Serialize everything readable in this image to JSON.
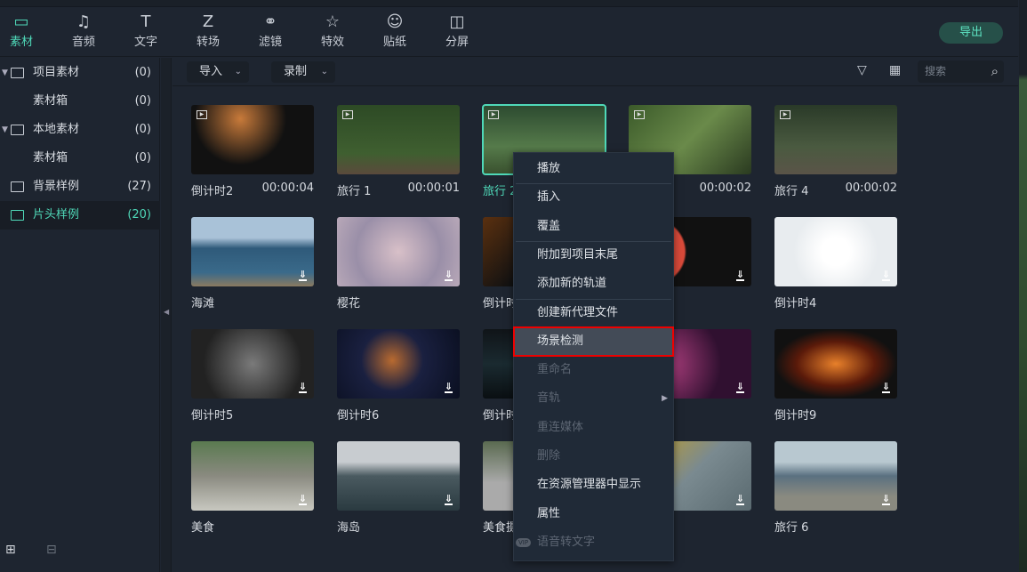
{
  "tabs": [
    {
      "label": "素材",
      "icon": "media-icon",
      "glyph": "▭"
    },
    {
      "label": "音频",
      "icon": "music-icon",
      "glyph": "♫"
    },
    {
      "label": "文字",
      "icon": "text-icon",
      "glyph": "T"
    },
    {
      "label": "转场",
      "icon": "transition-icon",
      "glyph": "Z"
    },
    {
      "label": "滤镜",
      "icon": "filter-icon",
      "glyph": "⚭"
    },
    {
      "label": "特效",
      "icon": "effects-icon",
      "glyph": "☆"
    },
    {
      "label": "贴纸",
      "icon": "sticker-icon",
      "glyph": "☺"
    },
    {
      "label": "分屏",
      "icon": "splitscreen-icon",
      "glyph": "◫"
    }
  ],
  "export_label": "导出",
  "sidebar": [
    {
      "label": "项目素材",
      "count": "(0)",
      "expand": true
    },
    {
      "label": "素材箱",
      "count": "(0)",
      "child": true
    },
    {
      "label": "本地素材",
      "count": "(0)",
      "expand": true
    },
    {
      "label": "素材箱",
      "count": "(0)",
      "child": true
    },
    {
      "label": "背景样例",
      "count": "(27)"
    },
    {
      "label": "片头样例",
      "count": "(20)",
      "selected": true
    }
  ],
  "toolbar": {
    "import": "导入",
    "record": "录制",
    "search_placeholder": "搜索"
  },
  "media": [
    {
      "name": "倒计时2",
      "dur": "00:00:04",
      "bg": "radial-gradient(circle at 40% 20%,#c87a3a,#111 50%),#111"
    },
    {
      "name": "旅行 1",
      "dur": "00:00:01",
      "bg": "linear-gradient(#2d4a25,#3f5f30 70%,#5b4a3c)"
    },
    {
      "name": "旅行 2",
      "dur": "",
      "bg": "linear-gradient(#2c4a30,#557a4a 60%,#39502e)",
      "selected": true
    },
    {
      "name": "",
      "dur": "00:00:02",
      "bg": "linear-gradient(135deg,#3b5a2a,#6a8a4a,#2a3a20)"
    },
    {
      "name": "旅行 4",
      "dur": "00:00:02",
      "bg": "linear-gradient(#2a3a28,#4a5a40 60%,#5a5448)"
    },
    {
      "name": "海滩",
      "dur": "",
      "bg": "linear-gradient(#a9c2d8 30%,#2f5a7a 45%,#3a6a8a 80%,#8a7a60)",
      "dl": true
    },
    {
      "name": "樱花",
      "dur": "",
      "bg": "radial-gradient(circle,#d8c0c8,#9a8fa8 60%,#b8a8b8)",
      "dl": true
    },
    {
      "name": "倒计时",
      "dur": "",
      "bg": "linear-gradient(135deg,#5a3010,#111 50%)",
      "dl": true
    },
    {
      "name": "",
      "dur": "",
      "bg": "radial-gradient(circle at 20% 50%,#d84a3a 30%,#111 32%)",
      "dl": true
    },
    {
      "name": "倒计时4",
      "dur": "",
      "bg": "radial-gradient(circle at 50% 50%,#fff 20%,#e8ecef 60%)",
      "dl": true
    },
    {
      "name": "倒计时5",
      "dur": "",
      "bg": "radial-gradient(circle,#7a7a7a,#222 70%)",
      "dl": true
    },
    {
      "name": "倒计时6",
      "dur": "",
      "bg": "radial-gradient(circle at 45% 45%,#b86a30,#1a2040 40%,#0a0f20)",
      "dl": true
    },
    {
      "name": "倒计时",
      "dur": "",
      "bg": "linear-gradient(#101418,#1a2a30,#0a0f12)",
      "dl": true
    },
    {
      "name": "",
      "dur": "",
      "bg": "radial-gradient(circle at 30% 50%,#b04080,#301030 60%)",
      "dl": true
    },
    {
      "name": "倒计时9",
      "dur": "",
      "bg": "radial-gradient(ellipse at 50% 50%,#e8802a,#5a1a0a 45%,#111 70%)",
      "dl": true
    },
    {
      "name": "美食",
      "dur": "",
      "bg": "linear-gradient(#5a7a50,#8a8a80 50%,#c8c8c0)",
      "dl": true
    },
    {
      "name": "海岛",
      "dur": "",
      "bg": "linear-gradient(#c8ccd0 30%,#4a5a60 50%,#2a3a40)",
      "dl": true
    },
    {
      "name": "美食摄",
      "dur": "",
      "bg": "linear-gradient(#5a6a50,#aaa 60%)",
      "dl": true
    },
    {
      "name": "",
      "dur": "",
      "bg": "linear-gradient(135deg,#c8a020,#7a8a90 50%,#5a6a70)",
      "dl": true
    },
    {
      "name": "旅行 6",
      "dur": "",
      "bg": "linear-gradient(#b8c8d0 30%,#5a7080 50%,#8a8a80 80%)",
      "dl": true
    }
  ],
  "menu": [
    {
      "label": "播放"
    },
    {
      "sep": true
    },
    {
      "label": "插入"
    },
    {
      "label": "覆盖"
    },
    {
      "sep": true
    },
    {
      "label": "附加到项目末尾"
    },
    {
      "label": "添加新的轨道"
    },
    {
      "sep": true
    },
    {
      "label": "创建新代理文件"
    },
    {
      "label": "场景检测",
      "highlight": true
    },
    {
      "label": "重命名",
      "disabled": true
    },
    {
      "label": "音轨",
      "disabled": true,
      "submenu": true
    },
    {
      "label": "重连媒体",
      "disabled": true
    },
    {
      "label": "删除",
      "disabled": true
    },
    {
      "label": "在资源管理器中显示"
    },
    {
      "label": "属性"
    },
    {
      "label": "语音转文字",
      "disabled": true,
      "vip": "VIP"
    }
  ]
}
